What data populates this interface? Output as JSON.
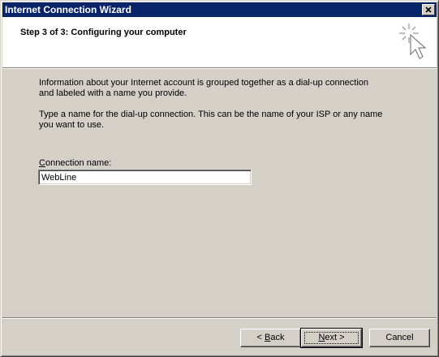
{
  "window": {
    "title": "Internet Connection Wizard"
  },
  "header": {
    "step_title": "Step 3 of 3: Configuring your computer",
    "icon": "wizard-cursor-sparkle-icon"
  },
  "body": {
    "paragraph1_line1": "Information about your Internet account is grouped together as a dial-up connection",
    "paragraph1_line2": "and labeled with a name you provide.",
    "paragraph2_line1": "Type a name for the dial-up connection. This can be the name of your ISP or any name",
    "paragraph2_line2": "you want to use.",
    "field_label_accel": "C",
    "field_label_rest": "onnection name:",
    "connection_name_value": "WebLine"
  },
  "buttons": {
    "back_prefix": "< ",
    "back_accel": "B",
    "back_rest": "ack",
    "next_accel": "N",
    "next_rest": "ext >",
    "cancel_label": "Cancel"
  }
}
